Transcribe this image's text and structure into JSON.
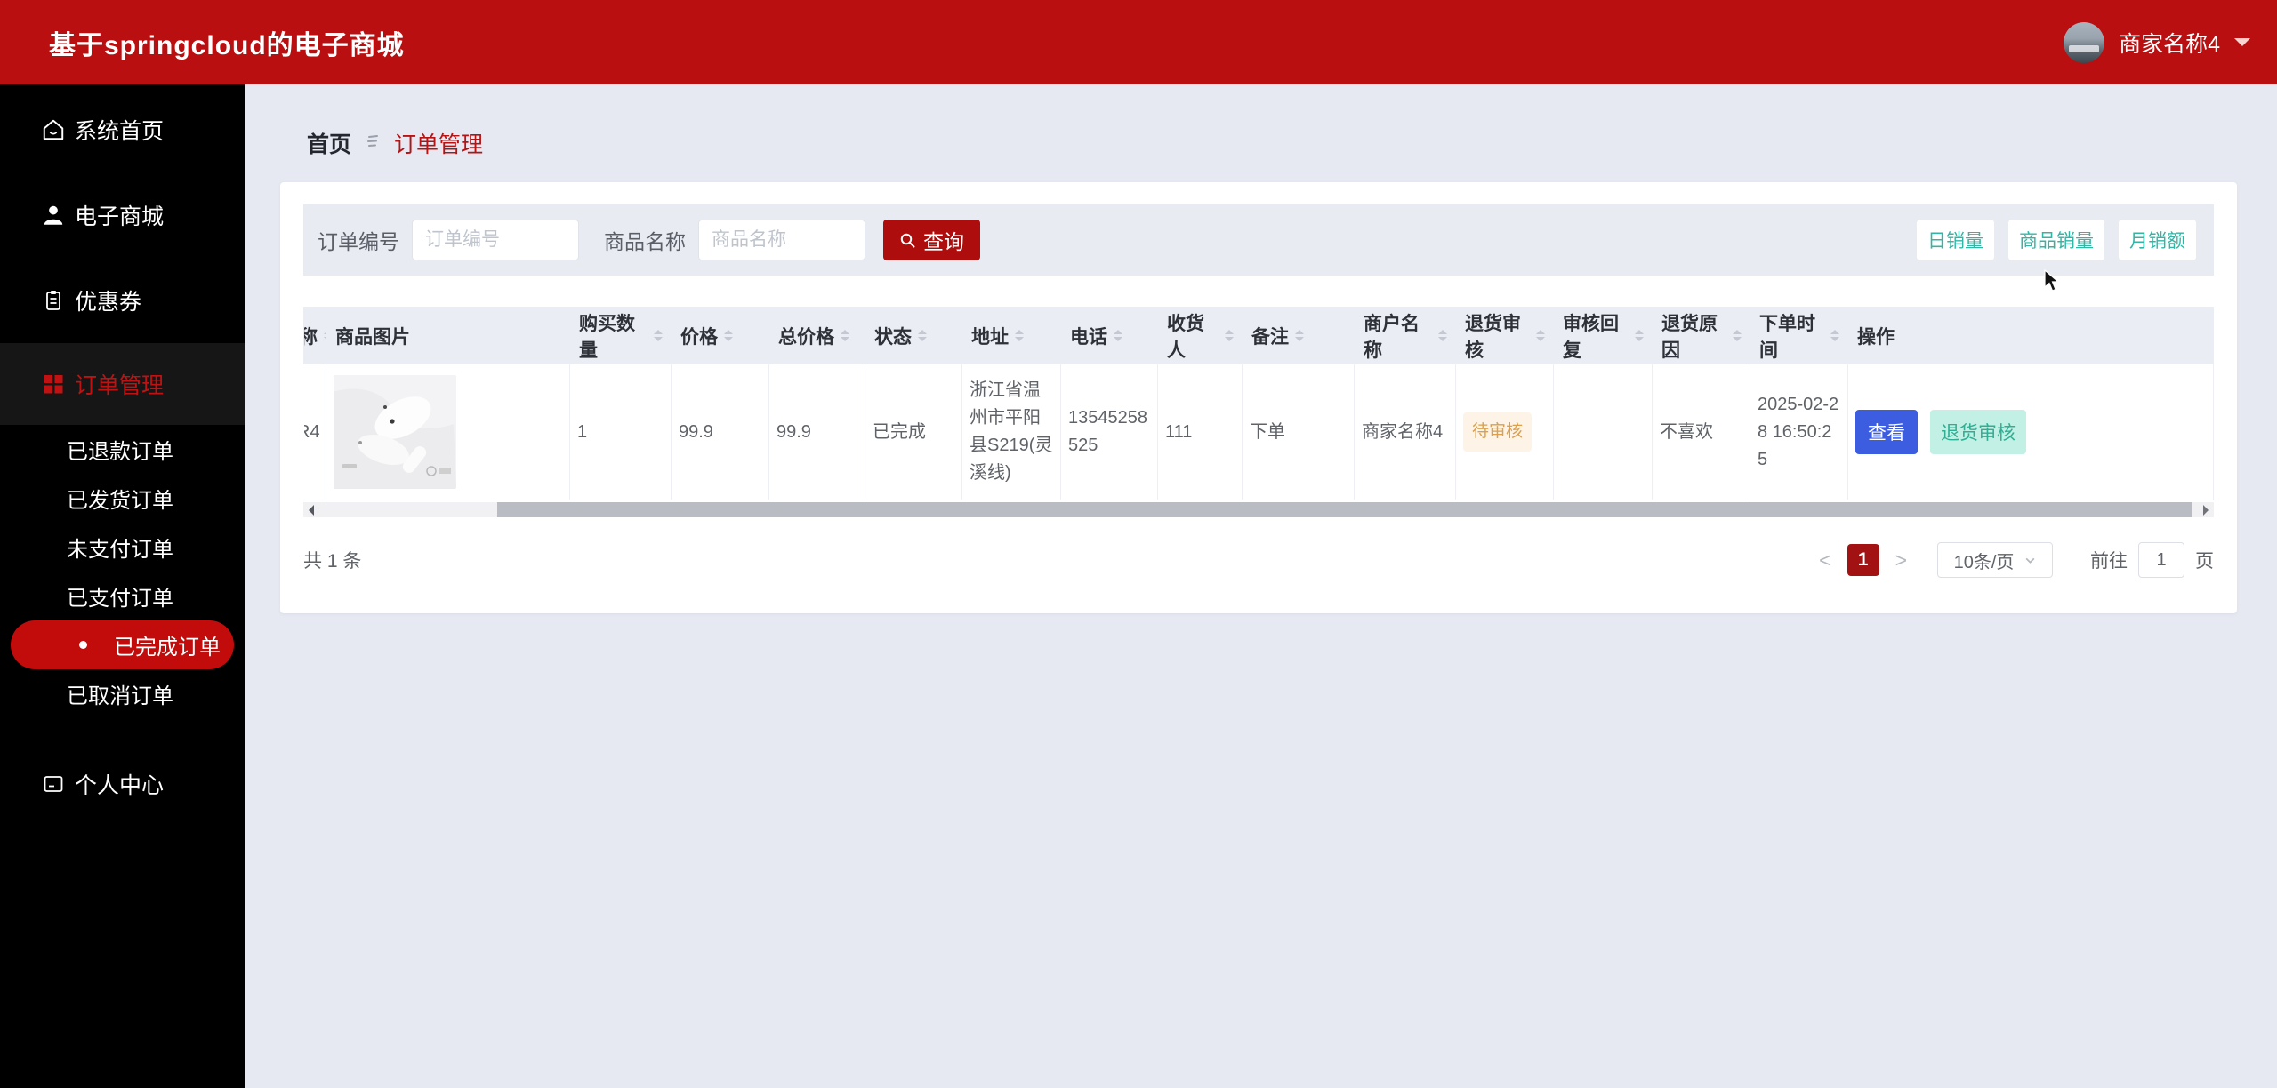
{
  "header": {
    "title": "基于springcloud的电子商城",
    "user_name": "商家名称4"
  },
  "breadcrumb": {
    "home": "首页",
    "current": "订单管理"
  },
  "sidebar": {
    "top": [
      {
        "label": "系统首页",
        "icon": "home-icon"
      },
      {
        "label": "电子商城",
        "icon": "user-icon"
      },
      {
        "label": "优惠券",
        "icon": "coupon-icon"
      }
    ],
    "orders_group": {
      "label": "订单管理",
      "icon": "grid-icon"
    },
    "order_children": [
      {
        "label": "已退款订单"
      },
      {
        "label": "已发货订单"
      },
      {
        "label": "未支付订单"
      },
      {
        "label": "已支付订单"
      },
      {
        "label": "已完成订单",
        "active": true
      },
      {
        "label": "已取消订单"
      }
    ],
    "profile": {
      "label": "个人中心",
      "icon": "window-icon"
    }
  },
  "filters": {
    "order_no_label": "订单编号",
    "order_no_placeholder": "订单编号",
    "order_no_value": "",
    "product_label": "商品名称",
    "product_placeholder": "商品名称",
    "product_value": "",
    "search_label": "查询"
  },
  "stat_buttons": [
    {
      "label": "日销量"
    },
    {
      "label": "商品销量"
    },
    {
      "label": "月销额"
    }
  ],
  "table": {
    "clipped_column": {
      "header_fragment": "称",
      "cell_fragment": "R4"
    },
    "columns": [
      {
        "label": "商品图片",
        "sortable": false
      },
      {
        "label": "购买数量",
        "sortable": true
      },
      {
        "label": "价格",
        "sortable": true
      },
      {
        "label": "总价格",
        "sortable": true
      },
      {
        "label": "状态",
        "sortable": true
      },
      {
        "label": "地址",
        "sortable": true
      },
      {
        "label": "电话",
        "sortable": true
      },
      {
        "label": "收货人",
        "sortable": true
      },
      {
        "label": "备注",
        "sortable": true
      },
      {
        "label": "商户名称",
        "sortable": true
      },
      {
        "label": "退货审核",
        "sortable": true
      },
      {
        "label": "审核回复",
        "sortable": true
      },
      {
        "label": "退货原因",
        "sortable": true
      },
      {
        "label": "下单时间",
        "sortable": true
      },
      {
        "label": "操作",
        "sortable": false
      }
    ],
    "row": {
      "product_image": "earbuds-product-photo",
      "quantity": "1",
      "price": "99.9",
      "total_price": "99.9",
      "status": "已完成",
      "address": "浙江省温州市平阳县S219(灵溪线)",
      "phone": "13545258525",
      "receiver": "111",
      "remark": "下单",
      "merchant": "商家名称4",
      "refund_review": "待审核",
      "review_reply": "",
      "refund_reason": "不喜欢",
      "order_time": "2025-02-28 16:50:25",
      "actions": [
        {
          "label": "查看"
        },
        {
          "label": "退货审核"
        }
      ]
    }
  },
  "pagination": {
    "total_text": "共 1 条",
    "prev": "<",
    "next": ">",
    "current_page": "1",
    "page_size": "10条/页",
    "goto_label": "前往",
    "goto_value": "1",
    "page_unit": "页"
  },
  "colors": {
    "header_red": "#b90f10",
    "menu_active_red": "#c20c0c",
    "query_button_red": "#ad0d0d",
    "active_page_red": "#a31212",
    "teal_accent": "#33b5a5",
    "view_button_blue": "#3c5de0",
    "warn_tag_orange": "#dca04a",
    "page_background": "#e6e8f2"
  }
}
